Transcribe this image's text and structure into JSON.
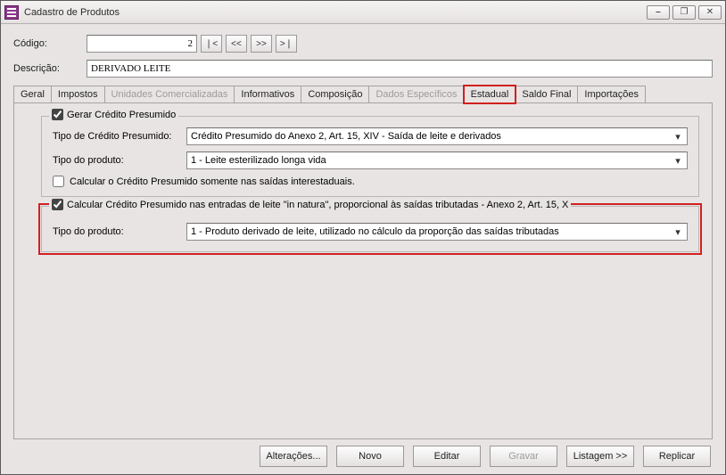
{
  "window": {
    "title": "Cadastro de Produtos",
    "min_icon": "⎯",
    "max_icon": "❐",
    "close_icon": "✕"
  },
  "form": {
    "codigo_label": "Código:",
    "codigo_value": "2",
    "nav_first": "❘<",
    "nav_prev": "<<",
    "nav_next": ">>",
    "nav_last": ">❘",
    "descricao_label": "Descrição:",
    "descricao_value": "DERIVADO LEITE"
  },
  "tabs": {
    "geral": "Geral",
    "impostos": "Impostos",
    "unidades": "Unidades Comercializadas",
    "informativos": "Informativos",
    "composicao": "Composição",
    "dados_esp": "Dados Específicos",
    "estadual": "Estadual",
    "saldo_final": "Saldo Final",
    "importacoes": "Importações"
  },
  "group1": {
    "legend": "Gerar Crédito Presumido",
    "checked": true,
    "tipo_credito_label": "Tipo de Crédito Presumido:",
    "tipo_credito_value": "Crédito Presumido do Anexo 2, Art. 15, XIV - Saída de leite e derivados",
    "tipo_produto_label": "Tipo do produto:",
    "tipo_produto_value": "1 - Leite esterilizado longa vida",
    "chk_interestaduais": "Calcular o Crédito Presumido somente nas saídas interestaduais.",
    "chk_interestaduais_checked": false
  },
  "group2": {
    "legend": "Calcular Crédito Presumido nas entradas de leite \"in natura\", proporcional às saídas tributadas - Anexo 2, Art. 15, X",
    "checked": true,
    "tipo_produto_label": "Tipo do produto:",
    "tipo_produto_value": "1 - Produto derivado de leite, utilizado no cálculo da proporção das saídas tributadas"
  },
  "footer": {
    "alteracoes": "Alterações...",
    "novo": "Novo",
    "editar": "Editar",
    "gravar": "Gravar",
    "listagem": "Listagem >>",
    "replicar": "Replicar"
  }
}
